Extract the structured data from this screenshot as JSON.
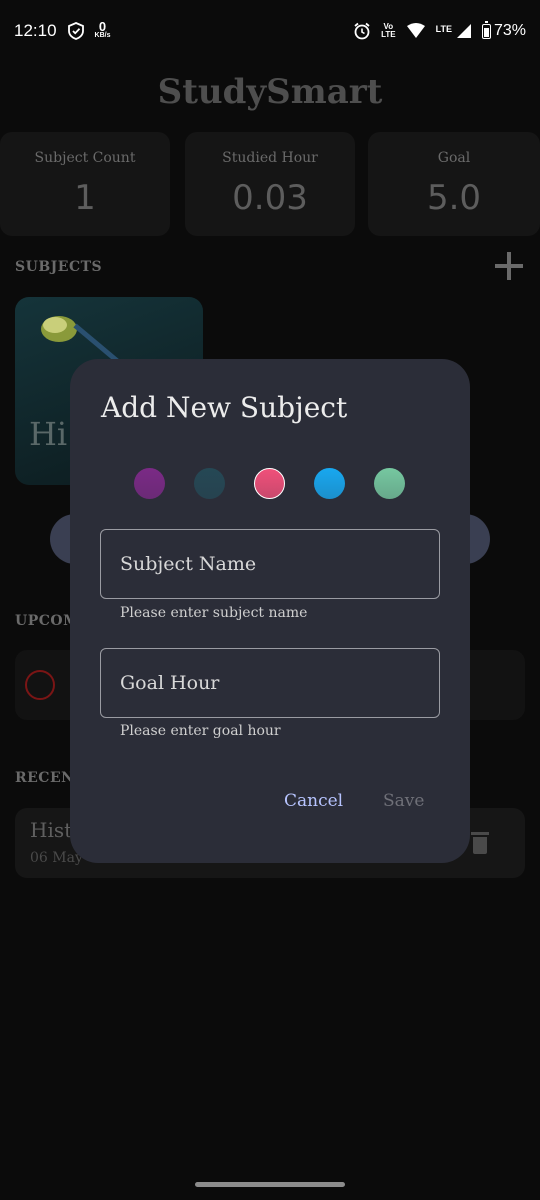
{
  "status_bar": {
    "time": "12:10",
    "net_speed_value": "0",
    "net_speed_unit": "KB/s",
    "volte_top": "Vo",
    "volte_bottom": "LTE",
    "lte": "LTE",
    "battery": "73%",
    "icons": [
      "shield-notification-icon",
      "alarm-icon",
      "wifi-icon",
      "signal-icon",
      "battery-icon"
    ]
  },
  "app": {
    "title": "StudySmart",
    "stats": [
      {
        "label": "Subject Count",
        "value": "1"
      },
      {
        "label": "Studied Hour",
        "value": "0.03"
      },
      {
        "label": "Goal",
        "value": "5.0"
      }
    ],
    "subjects_label": "SUBJECTS",
    "subject_card_text": "Hi",
    "upcoming_label": "UPCOM",
    "recent_label": "RECENT",
    "recent_session_title": "Hist",
    "recent_session_date": "06 May"
  },
  "dialog": {
    "title": "Add New Subject",
    "colors": [
      "#7b2a86",
      "#254855",
      "#f0507a",
      "#18a8f0",
      "#76c8a0"
    ],
    "selected_color_index": 2,
    "subject_name": {
      "placeholder": "Subject Name",
      "value": "",
      "helper": "Please enter subject name"
    },
    "goal_hour": {
      "placeholder": "Goal Hour",
      "value": "",
      "helper": "Please enter goal hour"
    },
    "cancel_label": "Cancel",
    "save_label": "Save"
  }
}
